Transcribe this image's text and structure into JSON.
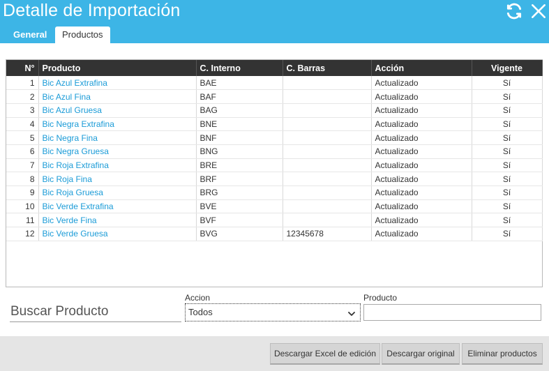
{
  "window": {
    "title": "Detalle de Importación"
  },
  "tabs": [
    {
      "label": "General"
    },
    {
      "label": "Productos"
    }
  ],
  "grid": {
    "columns": {
      "num": "N°",
      "producto": "Producto",
      "interno": "C. Interno",
      "barras": "C. Barras",
      "accion": "Acción",
      "vigente": "Vigente"
    },
    "rows": [
      {
        "num": "1",
        "producto": "Bic Azul Extrafina",
        "interno": "BAE",
        "barras": "",
        "accion": "Actualizado",
        "vigente": "Sí"
      },
      {
        "num": "2",
        "producto": "Bic Azul Fina",
        "interno": "BAF",
        "barras": "",
        "accion": "Actualizado",
        "vigente": "Sí"
      },
      {
        "num": "3",
        "producto": "Bic Azul Gruesa",
        "interno": "BAG",
        "barras": "",
        "accion": "Actualizado",
        "vigente": "Sí"
      },
      {
        "num": "4",
        "producto": "Bic Negra Extrafina",
        "interno": "BNE",
        "barras": "",
        "accion": "Actualizado",
        "vigente": "Sí"
      },
      {
        "num": "5",
        "producto": "Bic Negra Fina",
        "interno": "BNF",
        "barras": "",
        "accion": "Actualizado",
        "vigente": "Sí"
      },
      {
        "num": "6",
        "producto": "Bic Negra Gruesa",
        "interno": "BNG",
        "barras": "",
        "accion": "Actualizado",
        "vigente": "Sí"
      },
      {
        "num": "7",
        "producto": "Bic Roja Extrafina",
        "interno": "BRE",
        "barras": "",
        "accion": "Actualizado",
        "vigente": "Sí"
      },
      {
        "num": "8",
        "producto": "Bic Roja Fina",
        "interno": "BRF",
        "barras": "",
        "accion": "Actualizado",
        "vigente": "Sí"
      },
      {
        "num": "9",
        "producto": "Bic Roja Gruesa",
        "interno": "BRG",
        "barras": "",
        "accion": "Actualizado",
        "vigente": "Sí"
      },
      {
        "num": "10",
        "producto": "Bic Verde Extrafina",
        "interno": "BVE",
        "barras": "",
        "accion": "Actualizado",
        "vigente": "Sí"
      },
      {
        "num": "11",
        "producto": "Bic Verde Fina",
        "interno": "BVF",
        "barras": "",
        "accion": "Actualizado",
        "vigente": "Sí"
      },
      {
        "num": "12",
        "producto": "Bic Verde Gruesa",
        "interno": "BVG",
        "barras": "12345678",
        "accion": "Actualizado",
        "vigente": "Sí"
      }
    ]
  },
  "filters": {
    "search_label": "Buscar Producto",
    "accion_label": "Accion",
    "accion_value": "Todos",
    "producto_label": "Producto",
    "producto_value": ""
  },
  "buttons": {
    "excel": "Descargar Excel de edición",
    "original": "Descargar original",
    "eliminar": "Eliminar productos"
  },
  "colors": {
    "accent": "#3db5e6",
    "link": "#1a9bd7",
    "header_bg": "#333333"
  },
  "icons": {
    "refresh": "refresh-icon",
    "close": "close-icon",
    "select": "chevron-down-icon"
  }
}
